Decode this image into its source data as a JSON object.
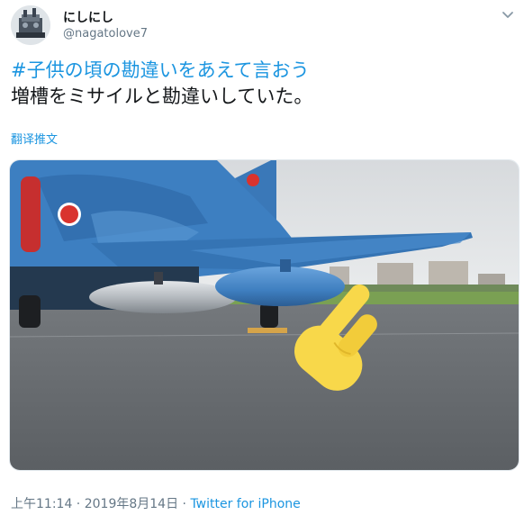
{
  "user": {
    "display_name": "にしにし",
    "handle": "@nagatolove7"
  },
  "tweet": {
    "hashtag": "#子供の頃の勘違いをあえて言おう",
    "body": "増槽をミサイルと勘違いしていた。",
    "translate_label": "翻译推文"
  },
  "photo": {
    "pointing_emoji": "👉"
  },
  "meta": {
    "time": "上午11:14",
    "separator1": " · ",
    "date": "2019年8月14日",
    "separator2": " · ",
    "source": "Twitter for iPhone"
  },
  "colors": {
    "link": "#1b95e0",
    "text": "#14171a",
    "secondary": "#657786",
    "jet_blue": "#3d7fc1",
    "tank_silver": "#b8bcc0",
    "emoji_yellow": "#f8d84a"
  }
}
